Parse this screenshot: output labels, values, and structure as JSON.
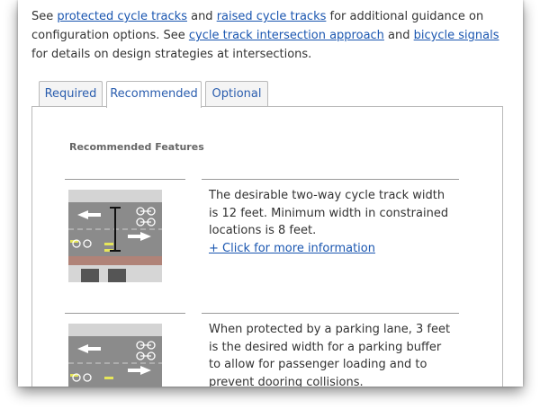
{
  "intro": {
    "t1": "See ",
    "link1": "protected cycle tracks",
    "t2": " and ",
    "link2": "raised cycle tracks",
    "t3": " for additional guidance on configuration options. See ",
    "link3": "cycle track intersection approach",
    "t4": " and ",
    "link4": "bicycle signals",
    "t5": " for details on design strategies at intersections."
  },
  "tabs": [
    {
      "label": "Required",
      "active": false
    },
    {
      "label": "Recommended",
      "active": true
    },
    {
      "label": "Optional",
      "active": false
    }
  ],
  "panel": {
    "section_title": "Recommended Features",
    "features": [
      {
        "text": "The desirable two-way cycle track width is 12 feet. Minimum width in constrained locations is 8 feet.",
        "link": "+ Click for more information",
        "icon": "cycle-track-width-diagram"
      },
      {
        "text": "When protected by a parking lane, 3 feet is the desired width for a parking buffer to allow for passenger loading and to prevent dooring collisions.",
        "icon": "parking-buffer-diagram"
      }
    ]
  },
  "colors": {
    "link": "#1a56b0",
    "tab_text": "#2a5dae",
    "border": "#b9b9b9",
    "road": "#8b8b8b",
    "buffer": "#b08378",
    "lane_marking": "#e6e65a"
  }
}
